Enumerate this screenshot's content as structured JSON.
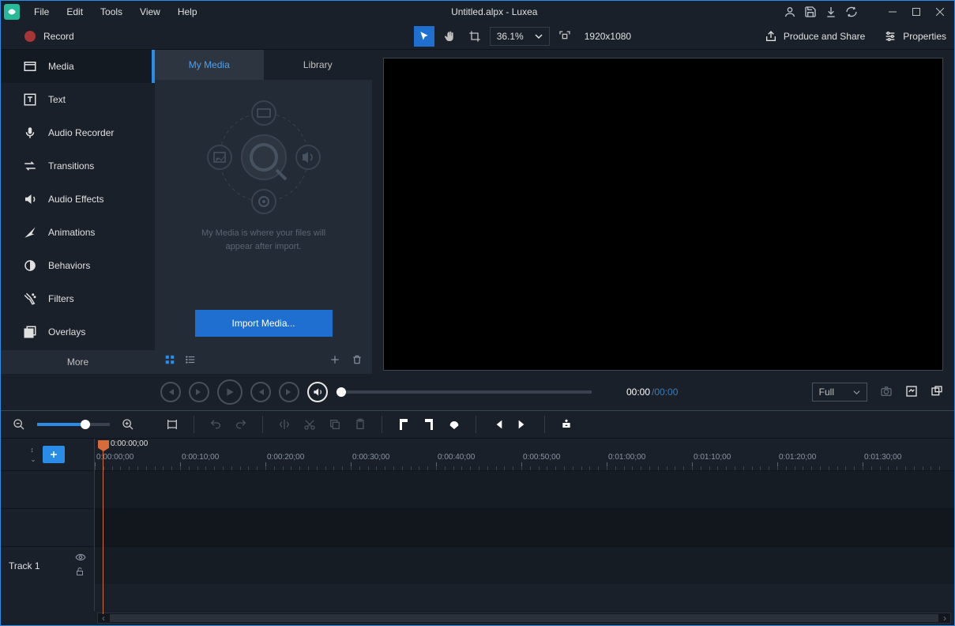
{
  "menu": {
    "items": [
      "File",
      "Edit",
      "Tools",
      "View",
      "Help"
    ]
  },
  "window": {
    "title": "Untitled.alpx - Luxea"
  },
  "record": {
    "label": "Record"
  },
  "toolbar": {
    "zoom": "36.1%",
    "resolution": "1920x1080",
    "produce": "Produce and Share",
    "properties": "Properties"
  },
  "sidebar": {
    "items": [
      {
        "label": "Media",
        "icon": "media"
      },
      {
        "label": "Text",
        "icon": "text"
      },
      {
        "label": "Audio Recorder",
        "icon": "mic"
      },
      {
        "label": "Transitions",
        "icon": "transitions"
      },
      {
        "label": "Audio Effects",
        "icon": "audio-effects"
      },
      {
        "label": "Animations",
        "icon": "animations"
      },
      {
        "label": "Behaviors",
        "icon": "behaviors"
      },
      {
        "label": "Filters",
        "icon": "filters"
      },
      {
        "label": "Overlays",
        "icon": "overlays"
      }
    ],
    "more": "More"
  },
  "media": {
    "tabs": {
      "my_media": "My Media",
      "library": "Library"
    },
    "hint_line1": "My Media is where your files will",
    "hint_line2": "appear after import.",
    "import_btn": "Import Media..."
  },
  "playback": {
    "current_time": "00:00",
    "total_time": "/00:00",
    "view_mode": "Full"
  },
  "timeline": {
    "playhead_time": "0:00:00;00",
    "ticks": [
      "0:00:00;00",
      "0:00:10;00",
      "0:00:20;00",
      "0:00:30;00",
      "0:00:40;00",
      "0:00:50;00",
      "0:01:00;00",
      "0:01:10;00",
      "0:01:20;00",
      "0:01:30;00"
    ],
    "track1": "Track 1"
  }
}
